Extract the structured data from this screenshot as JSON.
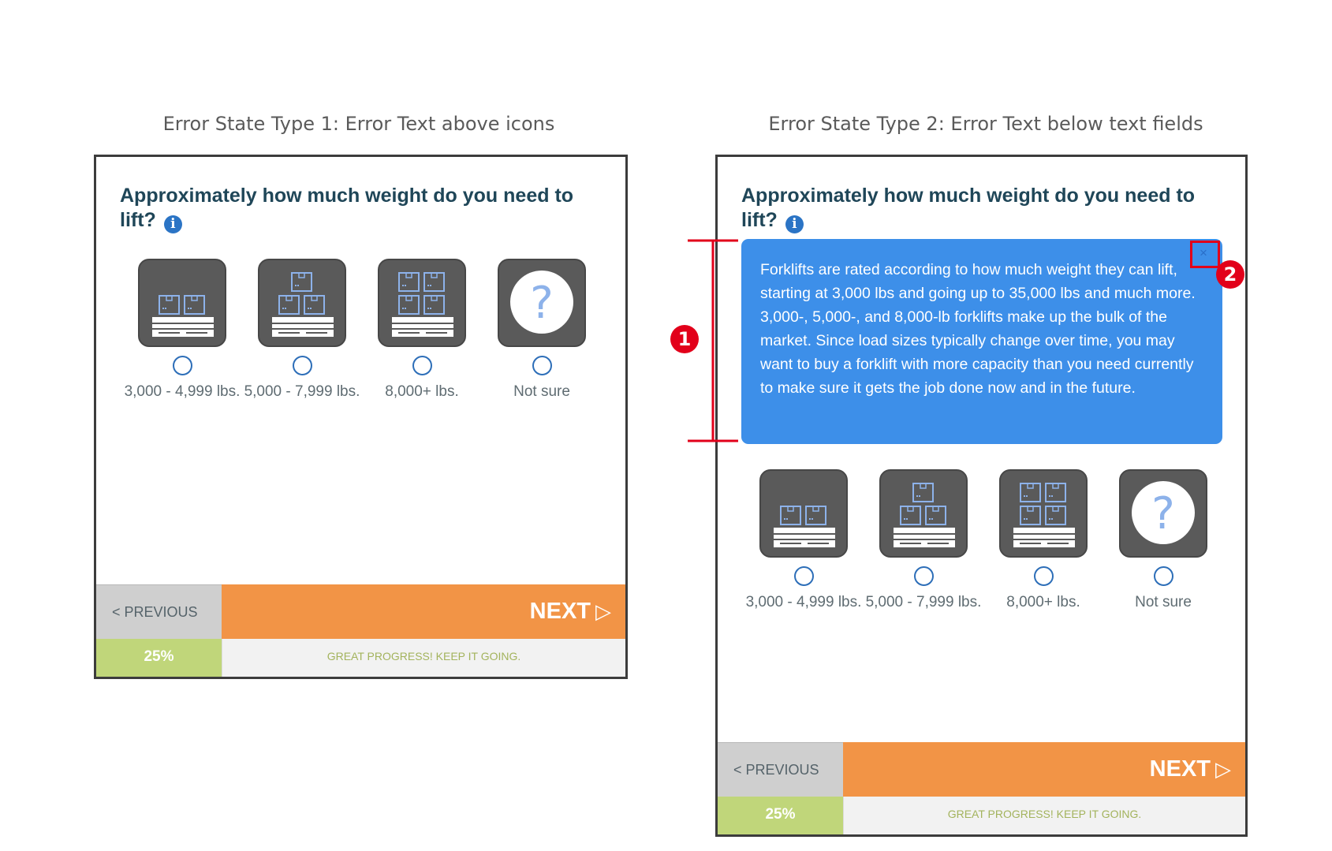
{
  "captions": {
    "left": "Error State Type 1: Error Text above icons",
    "right": "Error State Type 2: Error Text below text fields"
  },
  "question": "Approximately how much weight do you need to lift?",
  "info_icon_glyph": "i",
  "options": [
    {
      "icon": "pallet-two-boxes-icon",
      "label": "3,000 - 4,999 lbs."
    },
    {
      "icon": "pallet-three-boxes-icon",
      "label": "5,000 - 7,999 lbs."
    },
    {
      "icon": "pallet-four-boxes-icon",
      "label": "8,000+ lbs."
    },
    {
      "icon": "question-mark-icon",
      "label": "Not sure"
    }
  ],
  "tooltip": {
    "text": "Forklifts are rated according to how much weight they can lift, starting at 3,000 lbs and going up to 35,000 lbs and much more. 3,000-, 5,000-, and 8,000-lb forklifts make up the bulk of the market. Since load sizes typically change over time, you may want to buy a forklift with more capacity than you need currently to make sure it gets the job done now and in the future.",
    "close_glyph": "×"
  },
  "footer": {
    "previous_label": "< PREVIOUS",
    "next_label": "NEXT",
    "next_glyph": "▷",
    "progress_percent": "25%",
    "progress_message": "GREAT PROGRESS! KEEP IT GOING."
  },
  "annotations": {
    "marker_1": "1",
    "marker_2": "2"
  },
  "colors": {
    "accent_orange": "#f29446",
    "progress_green": "#c0d67a",
    "tooltip_blue": "#3d8fe9",
    "heading": "#1f4658",
    "annotation_red": "#e2001a"
  }
}
